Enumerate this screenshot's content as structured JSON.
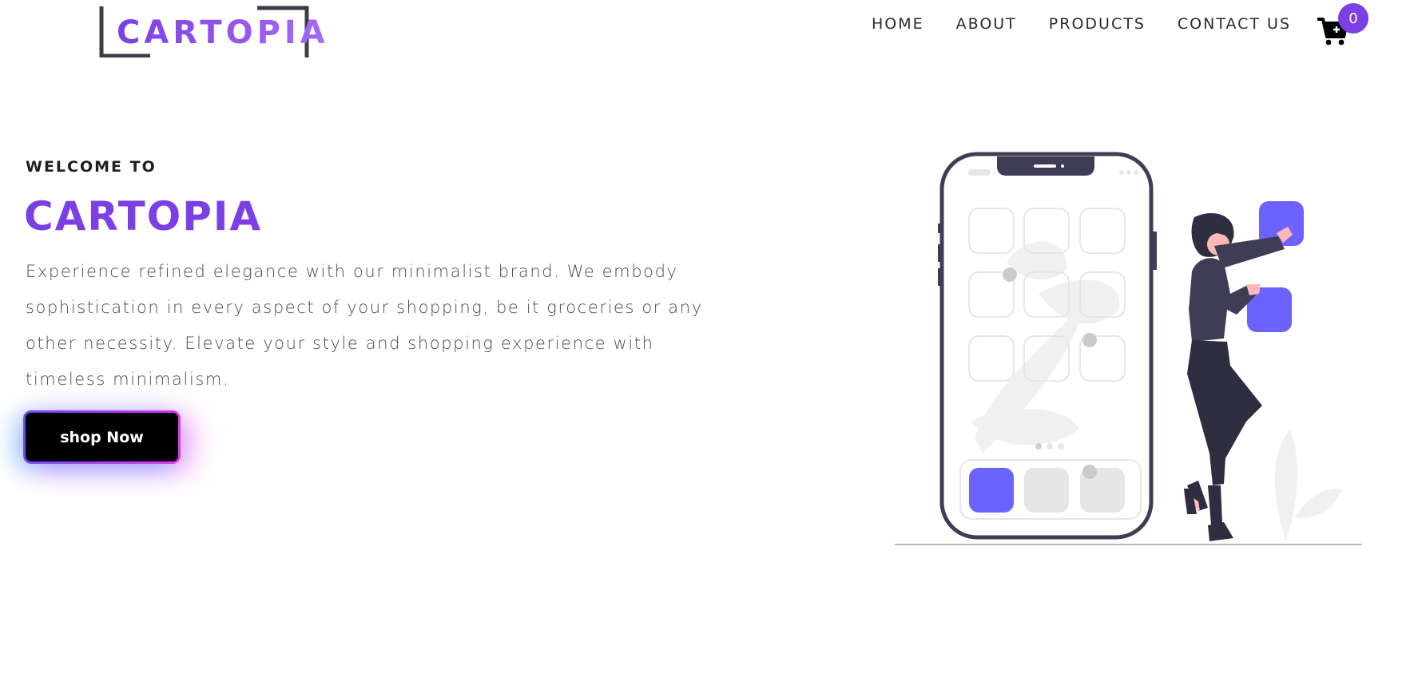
{
  "brand": {
    "name": "CARTOPIA"
  },
  "nav": {
    "items": [
      {
        "label": "HOME"
      },
      {
        "label": "ABOUT"
      },
      {
        "label": "PRODUCTS"
      },
      {
        "label": "CONTACT US"
      }
    ]
  },
  "cart": {
    "count": "0",
    "icon": "cart-plus-icon"
  },
  "hero": {
    "kicker": "WELCOME TO",
    "title": "CARTOPIA",
    "description": "Experience refined elegance with our minimalist brand. We embody sophistication in every aspect of your shopping, be it groceries or any other necessity. Elevate your style and shopping experience with timeless minimalism.",
    "cta_label": "shop Now"
  },
  "colors": {
    "accent": "#7b3fe4",
    "illustration_accent": "#6c63ff",
    "button_bg": "#000000",
    "text_dark": "#1f1f24"
  }
}
